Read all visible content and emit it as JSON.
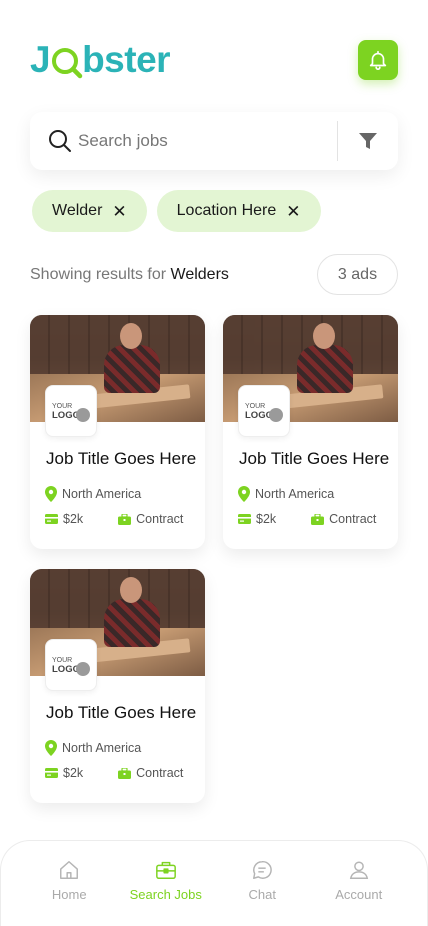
{
  "app": {
    "logo": {
      "j": "J",
      "rest": "bster"
    },
    "accent_color": "#7dd321",
    "brand_color": "#2bb3b7"
  },
  "header": {
    "notifications_icon": "bell-icon"
  },
  "search": {
    "placeholder": "Search jobs",
    "value": "",
    "filter_icon": "filter-icon"
  },
  "chips": [
    {
      "label": "Welder"
    },
    {
      "label": "Location Here"
    }
  ],
  "results": {
    "prefix": "Showing results for",
    "term": "Welders",
    "count_label": "3 ads"
  },
  "jobs": [
    {
      "logo_top": "YOUR",
      "logo_bottom": "LOGO",
      "title": "Job Title Goes Here",
      "location": "North America",
      "salary": "$2k",
      "type": "Contract"
    },
    {
      "logo_top": "YOUR",
      "logo_bottom": "LOGO",
      "title": "Job Title Goes Here",
      "location": "North America",
      "salary": "$2k",
      "type": "Contract"
    },
    {
      "logo_top": "YOUR",
      "logo_bottom": "LOGO",
      "title": "Job Title Goes Here",
      "location": "North America",
      "salary": "$2k",
      "type": "Contract"
    }
  ],
  "tabbar": {
    "items": [
      {
        "label": "Home",
        "icon": "home-icon",
        "active": false
      },
      {
        "label": "Search Jobs",
        "icon": "briefcase-icon",
        "active": true
      },
      {
        "label": "Chat",
        "icon": "chat-icon",
        "active": false
      },
      {
        "label": "Account",
        "icon": "user-icon",
        "active": false
      }
    ]
  }
}
